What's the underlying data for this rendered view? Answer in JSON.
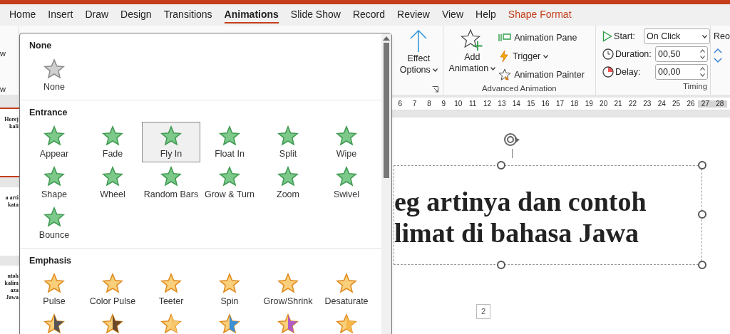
{
  "tabs": [
    {
      "label": "Home",
      "kind": "normal",
      "selected": false
    },
    {
      "label": "Insert",
      "kind": "normal",
      "selected": false
    },
    {
      "label": "Draw",
      "kind": "normal",
      "selected": false
    },
    {
      "label": "Design",
      "kind": "normal",
      "selected": false
    },
    {
      "label": "Transitions",
      "kind": "normal",
      "selected": false
    },
    {
      "label": "Animations",
      "kind": "normal",
      "selected": true
    },
    {
      "label": "Slide Show",
      "kind": "normal",
      "selected": false
    },
    {
      "label": "Record",
      "kind": "normal",
      "selected": false
    },
    {
      "label": "Review",
      "kind": "normal",
      "selected": false
    },
    {
      "label": "View",
      "kind": "normal",
      "selected": false
    },
    {
      "label": "Help",
      "kind": "normal",
      "selected": false
    },
    {
      "label": "Shape Format",
      "kind": "contextual",
      "selected": false
    }
  ],
  "ribbon": {
    "preview_fragments": [
      "w",
      "w"
    ],
    "effect_options": {
      "line1": "Effect",
      "line2": "Options"
    },
    "advanced_animation": {
      "add_line1": "Add",
      "add_line2": "Animation",
      "animation_pane": "Animation Pane",
      "trigger": "Trigger",
      "animation_painter": "Animation Painter",
      "label": "Advanced Animation"
    },
    "timing": {
      "start_label": "Start:",
      "start_value": "On Click",
      "duration_label": "Duration:",
      "duration_value": "00,50",
      "delay_label": "Delay:",
      "delay_value": "00,00",
      "label": "Timing"
    },
    "reorder_fragment": "Reo"
  },
  "ruler": [
    "6",
    "7",
    "8",
    "9",
    "10",
    "11",
    "12",
    "13",
    "14",
    "15",
    "16",
    "17",
    "18",
    "19",
    "20",
    "21",
    "22",
    "23",
    "24",
    "25",
    "26",
    "27",
    "28"
  ],
  "thumbnails": [
    {
      "lines": [
        "Horej",
        "kali"
      ],
      "selected": true
    },
    {
      "lines": [
        "a arti kata"
      ],
      "selected": false
    },
    {
      "lines": [
        "ntoh kalim",
        "aza Jawa"
      ],
      "selected": false
    }
  ],
  "gallery": {
    "sections": [
      {
        "title": "None",
        "kind": "none",
        "items": [
          {
            "label": "None",
            "selected": false
          }
        ]
      },
      {
        "title": "Entrance",
        "kind": "entrance",
        "items": [
          {
            "label": "Appear",
            "selected": false
          },
          {
            "label": "Fade",
            "selected": false
          },
          {
            "label": "Fly In",
            "selected": true
          },
          {
            "label": "Float In",
            "selected": false
          },
          {
            "label": "Split",
            "selected": false
          },
          {
            "label": "Wipe",
            "selected": false
          },
          {
            "label": "Shape",
            "selected": false
          },
          {
            "label": "Wheel",
            "selected": false
          },
          {
            "label": "Random Bars",
            "selected": false
          },
          {
            "label": "Grow & Turn",
            "selected": false
          },
          {
            "label": "Zoom",
            "selected": false
          },
          {
            "label": "Swivel",
            "selected": false
          },
          {
            "label": "Bounce",
            "selected": false
          }
        ]
      },
      {
        "title": "Emphasis",
        "kind": "emphasis",
        "items": [
          {
            "label": "Pulse",
            "selected": false
          },
          {
            "label": "Color Pulse",
            "selected": false
          },
          {
            "label": "Teeter",
            "selected": false
          },
          {
            "label": "Spin",
            "selected": false
          },
          {
            "label": "Grow/Shrink",
            "selected": false
          },
          {
            "label": "Desaturate",
            "selected": false
          },
          {
            "color": "#555555",
            "selected": false
          },
          {
            "color": "#6b4a2a",
            "selected": false
          },
          {
            "color": "#f6c66a",
            "selected": false
          },
          {
            "color": "#3b8fd6",
            "selected": false
          },
          {
            "color": "#b05cc7",
            "selected": false
          },
          {
            "color": "#f6b84a",
            "selected": false
          }
        ]
      }
    ]
  },
  "slide": {
    "title_lines": [
      "eg artinya dan contoh",
      "limat di bahasa Jawa"
    ],
    "slide_number": "2"
  }
}
